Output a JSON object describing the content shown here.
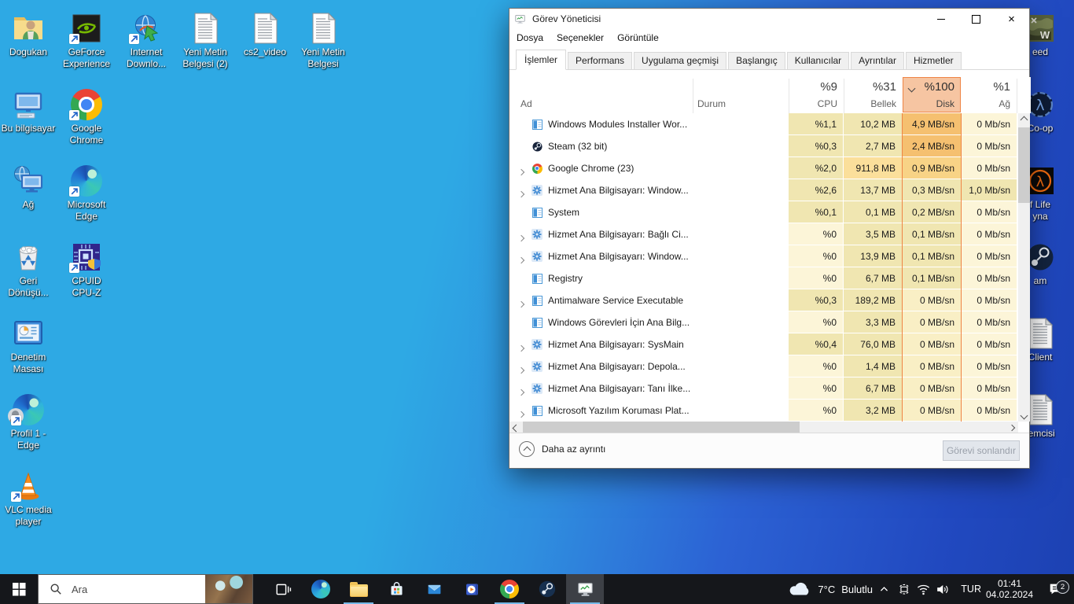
{
  "taskmanager": {
    "title": "Görev Yöneticisi",
    "menu": [
      "Dosya",
      "Seçenekler",
      "Görüntüle"
    ],
    "tabs": [
      "İşlemler",
      "Performans",
      "Uygulama geçmişi",
      "Başlangıç",
      "Kullanıcılar",
      "Ayrıntılar",
      "Hizmetler"
    ],
    "active_tab": "İşlemler",
    "columns": {
      "name": "Ad",
      "status": "Durum",
      "cpu_usage": "%9",
      "cpu": "CPU",
      "mem_usage": "%31",
      "mem": "Bellek",
      "disk_usage": "%100",
      "disk": "Disk",
      "net_usage": "%1",
      "net": "Ağ",
      "sorted_by": "disk"
    },
    "disk_highlight": {
      "header_bg": "#f6c5a2",
      "border": "#ef8445"
    },
    "heat_colors": {
      "0": "#fcf5d8",
      "1": "#f0e6b1",
      "2": "#fbdf9b",
      "3": "#f8d386",
      "4": "#f5c070",
      "z": "#f9efc5"
    },
    "processes": [
      {
        "name": "Windows Modules Installer Wor...",
        "icon": "winapp",
        "expand": false,
        "cpu": "%1,1",
        "mem": "10,2 MB",
        "disk": "4,9 MB/sn",
        "net": "0 Mb/sn",
        "heat": {
          "cpu": "1",
          "mem": "1",
          "disk": "4",
          "net": "0"
        }
      },
      {
        "name": "Steam (32 bit)",
        "icon": "steam",
        "expand": false,
        "cpu": "%0,3",
        "mem": "2,7 MB",
        "disk": "2,4 MB/sn",
        "net": "0 Mb/sn",
        "heat": {
          "cpu": "1",
          "mem": "1",
          "disk": "4",
          "net": "0"
        }
      },
      {
        "name": "Google Chrome (23)",
        "icon": "chrome",
        "expand": true,
        "cpu": "%2,0",
        "mem": "911,8 MB",
        "disk": "0,9 MB/sn",
        "net": "0 Mb/sn",
        "heat": {
          "cpu": "1",
          "mem": "2",
          "disk": "3",
          "net": "0"
        }
      },
      {
        "name": "Hizmet Ana Bilgisayarı: Window...",
        "icon": "gear",
        "expand": true,
        "cpu": "%2,6",
        "mem": "13,7 MB",
        "disk": "0,3 MB/sn",
        "net": "1,0 Mb/sn",
        "heat": {
          "cpu": "1",
          "mem": "1",
          "disk": "1",
          "net": "1"
        }
      },
      {
        "name": "System",
        "icon": "winapp",
        "expand": false,
        "cpu": "%0,1",
        "mem": "0,1 MB",
        "disk": "0,2 MB/sn",
        "net": "0 Mb/sn",
        "heat": {
          "cpu": "1",
          "mem": "1",
          "disk": "1",
          "net": "0"
        }
      },
      {
        "name": "Hizmet Ana Bilgisayarı: Bağlı Ci...",
        "icon": "gear",
        "expand": true,
        "cpu": "%0",
        "mem": "3,5 MB",
        "disk": "0,1 MB/sn",
        "net": "0 Mb/sn",
        "heat": {
          "cpu": "0",
          "mem": "1",
          "disk": "1",
          "net": "0"
        }
      },
      {
        "name": "Hizmet Ana Bilgisayarı: Window...",
        "icon": "gear",
        "expand": true,
        "cpu": "%0",
        "mem": "13,9 MB",
        "disk": "0,1 MB/sn",
        "net": "0 Mb/sn",
        "heat": {
          "cpu": "0",
          "mem": "1",
          "disk": "1",
          "net": "0"
        }
      },
      {
        "name": "Registry",
        "icon": "winapp",
        "expand": false,
        "cpu": "%0",
        "mem": "6,7 MB",
        "disk": "0,1 MB/sn",
        "net": "0 Mb/sn",
        "heat": {
          "cpu": "0",
          "mem": "1",
          "disk": "1",
          "net": "0"
        }
      },
      {
        "name": "Antimalware Service Executable",
        "icon": "winapp",
        "expand": true,
        "cpu": "%0,3",
        "mem": "189,2 MB",
        "disk": "0 MB/sn",
        "net": "0 Mb/sn",
        "heat": {
          "cpu": "1",
          "mem": "1",
          "disk": "z",
          "net": "0"
        }
      },
      {
        "name": "Windows Görevleri İçin Ana Bilg...",
        "icon": "winapp",
        "expand": false,
        "cpu": "%0",
        "mem": "3,3 MB",
        "disk": "0 MB/sn",
        "net": "0 Mb/sn",
        "heat": {
          "cpu": "0",
          "mem": "1",
          "disk": "z",
          "net": "0"
        }
      },
      {
        "name": "Hizmet Ana Bilgisayarı: SysMain",
        "icon": "gear",
        "expand": true,
        "cpu": "%0,4",
        "mem": "76,0 MB",
        "disk": "0 MB/sn",
        "net": "0 Mb/sn",
        "heat": {
          "cpu": "1",
          "mem": "1",
          "disk": "z",
          "net": "0"
        }
      },
      {
        "name": "Hizmet Ana Bilgisayarı: Depola...",
        "icon": "gear",
        "expand": true,
        "cpu": "%0",
        "mem": "1,4 MB",
        "disk": "0 MB/sn",
        "net": "0 Mb/sn",
        "heat": {
          "cpu": "0",
          "mem": "1",
          "disk": "z",
          "net": "0"
        }
      },
      {
        "name": "Hizmet Ana Bilgisayarı: Tanı İlke...",
        "icon": "gear",
        "expand": true,
        "cpu": "%0",
        "mem": "6,7 MB",
        "disk": "0 MB/sn",
        "net": "0 Mb/sn",
        "heat": {
          "cpu": "0",
          "mem": "1",
          "disk": "z",
          "net": "0"
        }
      },
      {
        "name": "Microsoft Yazılım Koruması Plat...",
        "icon": "winapp",
        "expand": true,
        "cpu": "%0",
        "mem": "3,2 MB",
        "disk": "0 MB/sn",
        "net": "0 Mb/sn",
        "heat": {
          "cpu": "0",
          "mem": "1",
          "disk": "z",
          "net": "0"
        }
      }
    ],
    "footer": {
      "toggle_label": "Daha az ayrıntı",
      "end_task_label": "Görevi sonlandır",
      "end_task_enabled": false
    }
  },
  "desktop": {
    "icons": [
      {
        "label": "Dogukan",
        "icon": "user-folder",
        "col": 0,
        "row": 0,
        "shortcut": false
      },
      {
        "label": "GeForce\nExperience",
        "icon": "nvidia",
        "col": 1,
        "row": 0,
        "shortcut": true
      },
      {
        "label": "Internet\nDownlo...",
        "icon": "idm",
        "col": 2,
        "row": 0,
        "shortcut": true
      },
      {
        "label": "Yeni Metin\nBelgesi (2)",
        "icon": "textdoc",
        "col": 3,
        "row": 0,
        "shortcut": false
      },
      {
        "label": "cs2_video",
        "icon": "textdoc",
        "col": 4,
        "row": 0,
        "shortcut": false
      },
      {
        "label": "Yeni Metin\nBelgesi",
        "icon": "textdoc",
        "col": 5,
        "row": 0,
        "shortcut": false
      },
      {
        "label": "Bu bilgisayar",
        "icon": "thispc",
        "col": 0,
        "row": 1,
        "shortcut": false
      },
      {
        "label": "Google\nChrome",
        "icon": "chrome",
        "col": 1,
        "row": 1,
        "shortcut": true
      },
      {
        "label": "Ağ",
        "icon": "network",
        "col": 0,
        "row": 2,
        "shortcut": false
      },
      {
        "label": "Microsoft\nEdge",
        "icon": "edge",
        "col": 1,
        "row": 2,
        "shortcut": true
      },
      {
        "label": "Geri\nDönüşü...",
        "icon": "recycle",
        "col": 0,
        "row": 3,
        "shortcut": false
      },
      {
        "label": "CPUID\nCPU-Z",
        "icon": "cpuz",
        "col": 1,
        "row": 3,
        "shortcut": true
      },
      {
        "label": "Denetim\nMasası",
        "icon": "controlpanel",
        "col": 0,
        "row": 4,
        "shortcut": false
      },
      {
        "label": "Profil 1 -\nEdge",
        "icon": "edge-profile",
        "col": 0,
        "row": 5,
        "shortcut": true
      },
      {
        "label": "VLC media\nplayer",
        "icon": "vlc",
        "col": 0,
        "row": 6,
        "shortcut": true
      }
    ],
    "right_icons": [
      {
        "label": "eed",
        "icon": "military",
        "row": 0
      },
      {
        "label": "Co-op",
        "icon": "lambda-blue",
        "row": 1
      },
      {
        "label": "f Life\nyna",
        "icon": "lambda-orange",
        "row": 2
      },
      {
        "label": "am",
        "icon": "steam",
        "row": 3
      },
      {
        "label": "Client",
        "icon": "textdoc",
        "row": 4
      },
      {
        "label": "temcisi",
        "icon": "textdoc",
        "row": 5
      }
    ]
  },
  "taskbar": {
    "search": {
      "placeholder": "Ara"
    },
    "apps": [
      {
        "id": "task-view",
        "running": false,
        "active": false
      },
      {
        "id": "edge",
        "running": false,
        "active": false
      },
      {
        "id": "file-explorer",
        "running": true,
        "active": false
      },
      {
        "id": "store",
        "running": false,
        "active": false
      },
      {
        "id": "mail",
        "running": false,
        "active": false
      },
      {
        "id": "movies-tv",
        "running": false,
        "active": false
      },
      {
        "id": "chrome",
        "running": true,
        "active": false
      },
      {
        "id": "steam",
        "running": false,
        "active": false
      },
      {
        "id": "task-manager",
        "running": true,
        "active": true
      }
    ],
    "tray": {
      "weather_temp": "7°C",
      "weather_cond": "Bulutlu",
      "lang": "TUR",
      "time": "01:41",
      "date": "04.02.2024",
      "notif_count": "2"
    }
  }
}
